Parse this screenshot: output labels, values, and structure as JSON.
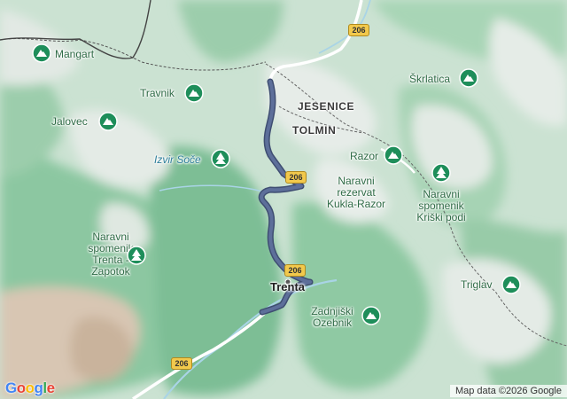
{
  "map": {
    "places": {
      "mangart": "Mangart",
      "travnik": "Travnik",
      "jalovec": "Jalovec",
      "izvir_soce": "Izvir Soče",
      "skrlatica": "Škrlatica",
      "razor": "Razor",
      "kukla_razor": [
        "Naravni",
        "rezervat",
        "Kukla-Razor"
      ],
      "kriski_podi": [
        "Naravni",
        "spomenik",
        "Kriški podi"
      ],
      "trenta_zapotok": [
        "Naravni",
        "spomenik",
        "Trenta -",
        "Zapotok"
      ],
      "triglav": "Triglav",
      "trenta": "Trenta",
      "zadnjiski_ozebnik": [
        "Zadnjiški",
        "Ozebnik"
      ]
    },
    "regions": {
      "jesenice": "JESENICE",
      "tolmin": "TOLMIN"
    },
    "road_shields": [
      "206",
      "206",
      "206",
      "206"
    ],
    "icons": {
      "peak": "mountain-peak-icon",
      "tree": "nature-reserve-icon"
    },
    "colors": {
      "route": "#4e5f86",
      "pin": "#1e8e5a",
      "water": "#a9d4e6",
      "shield": "#f2c94c"
    },
    "attribution": "Map data ©2026 Google",
    "logo": [
      "G",
      "o",
      "o",
      "g",
      "l",
      "e"
    ]
  }
}
